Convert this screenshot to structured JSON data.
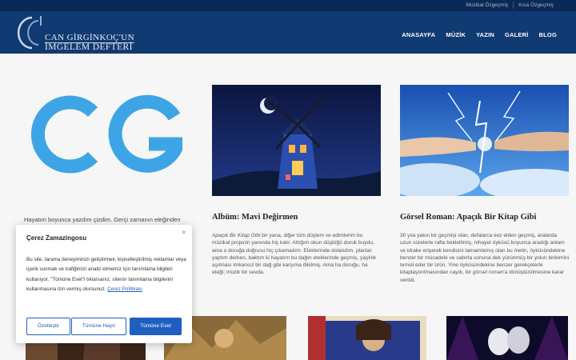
{
  "topbar": {
    "links": [
      "Müzikal Özgeçmiş",
      "Kısa Özgeçmiş"
    ]
  },
  "header": {
    "logo_line1": "CAN GİRGİNKOÇ'UN",
    "logo_line2": "İMGELEM DEFTERİ",
    "nav": [
      "ANASAYFA",
      "MÜZİK",
      "YAZIN",
      "GALERİ",
      "BLOG"
    ]
  },
  "intro": {
    "text": "Hayatım boyunca yazdım çizdim. Gerçi zamanın eleğinden"
  },
  "cards": [
    {
      "title": "Albüm: Mavi Değirmen",
      "text_italic": "Apaçık Bir Kitap Gibi",
      "text": " bir yana, diğer tüm düşlem ve edimlerim bu müzikal projenin yanında hiç kalır. Attığım okun düştüğü doruk buydu, ama o doruğa doğrusu hiç çıkamadım. Eteklerinde dolandım, planlar yaptım derken, baktım ki hayatım bu dağın eteklerinde geçmiş, yaşlılık aşılması imkansız bir dağ gibi karşıma dikilmiş. Ama ha doruğu, ha eteği; müzik bir sevda."
    },
    {
      "title": "Görsel Roman: Apaçık Bir Kitap Gibi",
      "text": "30 yıla yakın bir geçmişi olan, defalarca kez elden geçmiş, aralarda uzun sürelerle rafta bekletilmiş, nihayet öyküsü boyunca aradığı anlam ve idrake erişerek kendisini tamamlamış olan bu metin, öyküsündekine benzer bir mücadele ve sabırla sonuna dek yürünmüş bir yolun birikimini temsil eder bir ürün. Yine öyküsündekine benzer gerekçelerle kitaplaştırılmasından caydı, bir ",
      "text_italic_end": "görsel roman",
      "text_end": "'a dönüştürülmesine karar verildi."
    }
  ],
  "cookie": {
    "title": "Çerez Zamazingosu",
    "close": "×",
    "body": "Bu site, tarama deneyiminizi geliştirmek, kişiselleştirilmiş reklamlar veya içerik sunmak ve trafiğimizi analiz etmemiz için tanımlama bilgileri kullanıyor. \"Tümüne Evet\"i tıklarsanız, sitenin tanımlama bilgilerini kullanmasına izin vermiş olursunuz.",
    "link": "Çerez Politikası",
    "btn_customize": "Özelleştir",
    "btn_reject": "Tümüne Hayır",
    "btn_accept": "Tümüne Evet"
  },
  "colors": {
    "topbar": "#0a2a55",
    "header": "#103a72",
    "accent": "#1f5fbf",
    "logo_blue": "#3da5e6"
  }
}
